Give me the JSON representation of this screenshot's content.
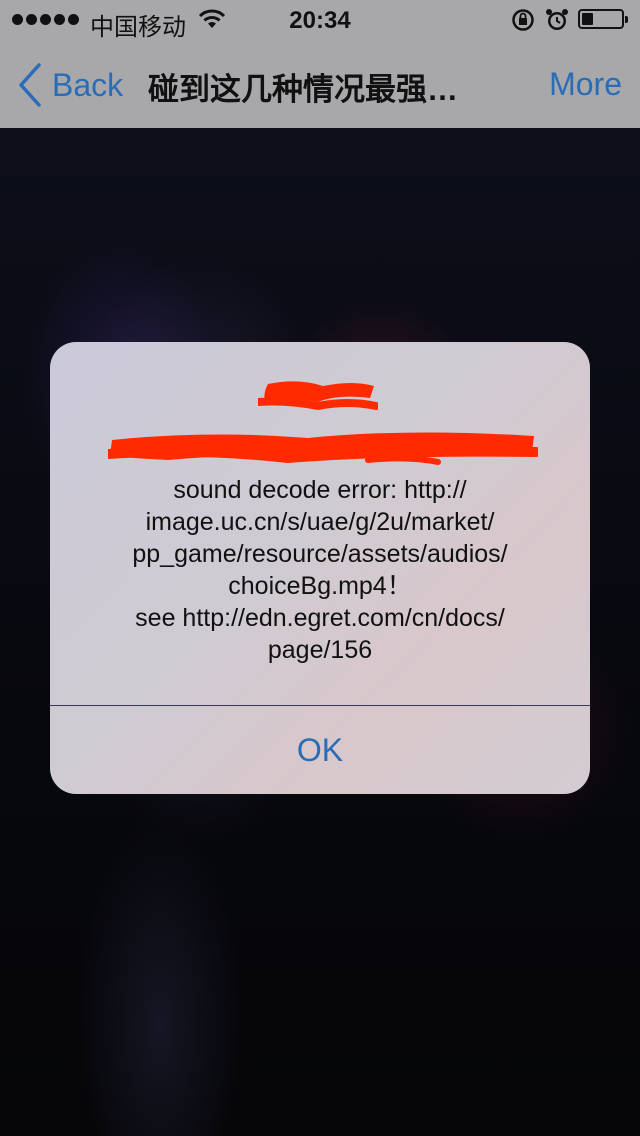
{
  "status_bar": {
    "carrier": "中国移动",
    "time": "20:34",
    "battery_level": 0.3
  },
  "nav": {
    "back_label": "Back",
    "title": "碰到这几种情况最强…",
    "more_label": "More"
  },
  "alert": {
    "title": "",
    "subtitle": "",
    "message_lines": [
      "sound decode error: http://",
      "image.uc.cn/s/uae/g/2u/market/",
      "pp_game/resource/assets/audios/",
      "choiceBg.mp4！",
      "see http://edn.egret.com/cn/docs/",
      "page/156"
    ],
    "ok_label": "OK"
  },
  "colors": {
    "accent": "#2a6cb6",
    "bar_bg": "#a8a8ab",
    "redaction": "#ff2a00"
  },
  "icons": [
    "signal-dots-icon",
    "wifi-icon",
    "rotation-lock-icon",
    "alarm-icon",
    "battery-icon",
    "chevron-left-icon"
  ]
}
